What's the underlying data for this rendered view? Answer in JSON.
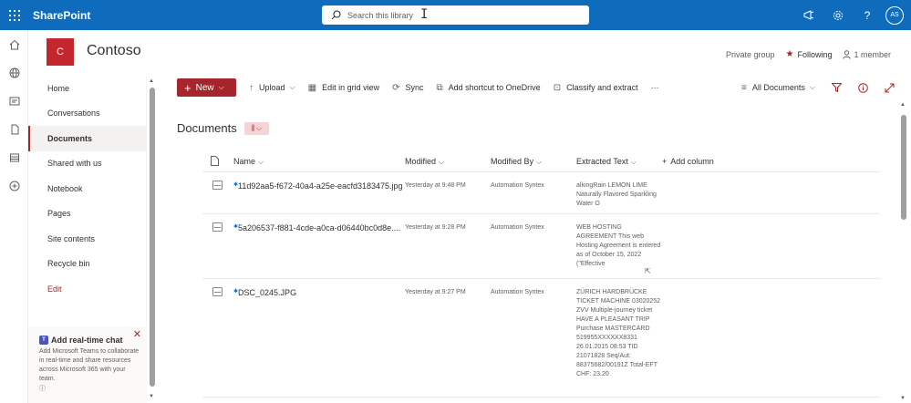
{
  "suite": {
    "app_name": "SharePoint",
    "search_placeholder": "Search this library",
    "avatar_initials": "AS"
  },
  "site": {
    "logo_letter": "C",
    "title": "Contoso",
    "privacy": "Private group",
    "following_label": "Following",
    "members_label": "1 member"
  },
  "nav": {
    "items": [
      {
        "label": "Home"
      },
      {
        "label": "Conversations"
      },
      {
        "label": "Documents"
      },
      {
        "label": "Shared with us"
      },
      {
        "label": "Notebook"
      },
      {
        "label": "Pages"
      },
      {
        "label": "Site contents"
      },
      {
        "label": "Recycle bin"
      },
      {
        "label": "Edit"
      }
    ],
    "active_index": 2
  },
  "chat_card": {
    "title": "Add real-time chat",
    "body": "Add Microsoft Teams to collaborate in real-time and share resources across Microsoft 365 with your team."
  },
  "commandbar": {
    "new_label": "New",
    "upload_label": "Upload",
    "grid_label": "Edit in grid view",
    "sync_label": "Sync",
    "shortcut_label": "Add shortcut to OneDrive",
    "classify_label": "Classify and extract",
    "more_label": "···",
    "view_label": "All Documents"
  },
  "library": {
    "title": "Documents",
    "columns": {
      "name": "Name",
      "modified": "Modified",
      "modified_by": "Modified By",
      "extracted": "Extracted Text",
      "add": "Add column"
    },
    "rows": [
      {
        "name": "11d92aa5-f672-40a4-a25e-eacfd3183475.jpg",
        "modified": "Yesterday at 9:48 PM",
        "modified_by": "Automation Syntex",
        "extracted": "alkingRain LEMON LIME Naturally Flavored Sparkling Water O"
      },
      {
        "name": "5a206537-f881-4cde-a0ca-d06440bc0d8e....",
        "modified": "Yesterday at 9:28 PM",
        "modified_by": "Automation Syntex",
        "extracted": "WEB HOSTING AGREEMENT This web Hosting Agreement is entered as of October 15, 2022 (\"Effective"
      },
      {
        "name": "DSC_0245.JPG",
        "modified": "Yesterday at 9:27 PM",
        "modified_by": "Automation Syntex",
        "extracted": "ZÜRICH HARDBRÜCKE TICKET MACHINE 03020252 ZVV Multiple-journey ticket HAVE A PLEASANT TRIP Purchase MASTERCARD 519955XXXXXX8331 26.01.2015 08:53 TID 21071828 Seq/Aut: 88375682/00191Z Total-EFT CHF: 23.20"
      }
    ]
  },
  "colors": {
    "suite_blue": "#0f6cbd",
    "accent_red": "#a4262c"
  }
}
